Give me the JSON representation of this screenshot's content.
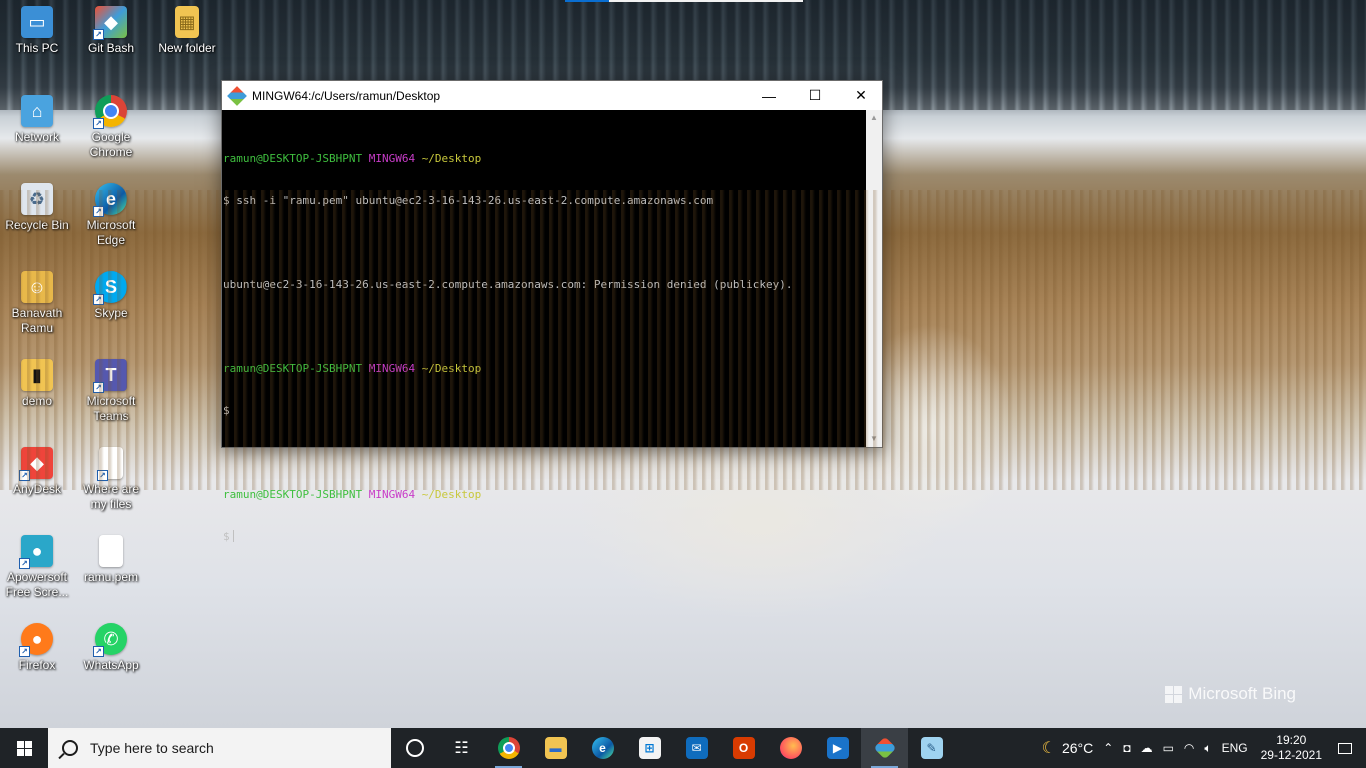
{
  "desktop_icons": [
    {
      "label": "This PC",
      "icon": "computer-icon"
    },
    {
      "label": "Git Bash",
      "icon": "git-bash-icon"
    },
    {
      "label": "New folder",
      "icon": "folder-icon"
    },
    {
      "label": "Network",
      "icon": "network-icon"
    },
    {
      "label": "Google\nChrome",
      "icon": "chrome-icon"
    },
    {
      "label": "Recycle Bin",
      "icon": "recycle-bin-icon"
    },
    {
      "label": "Microsoft\nEdge",
      "icon": "edge-icon"
    },
    {
      "label": "Banavath\nRamu",
      "icon": "user-folder-icon"
    },
    {
      "label": "Skype",
      "icon": "skype-icon"
    },
    {
      "label": "demo",
      "icon": "file-icon"
    },
    {
      "label": "Microsoft\nTeams",
      "icon": "teams-icon"
    },
    {
      "label": "AnyDesk",
      "icon": "anydesk-icon"
    },
    {
      "label": "Where are\nmy files",
      "icon": "document-icon"
    },
    {
      "label": "Apowersoft\nFree Scre...",
      "icon": "apowersoft-icon"
    },
    {
      "label": "ramu.pem",
      "icon": "document-icon"
    },
    {
      "label": "Firefox",
      "icon": "firefox-icon"
    },
    {
      "label": "WhatsApp",
      "icon": "whatsapp-icon"
    }
  ],
  "terminal": {
    "title": "MINGW64:/c/Users/ramun/Desktop",
    "buttons": {
      "minimize": "—",
      "maximize": "☐",
      "close": "✕"
    },
    "lines": [
      {
        "user": "ramun@DESKTOP-JSBHPNT",
        "env": "MINGW64",
        "path": "~/Desktop"
      },
      {
        "text": "$ ssh -i \"ramu.pem\" ubuntu@ec2-3-16-143-26.us-east-2.compute.amazonaws.com"
      },
      {
        "text": ""
      },
      {
        "text": "ubuntu@ec2-3-16-143-26.us-east-2.compute.amazonaws.com: Permission denied (publickey)."
      },
      {
        "text": ""
      },
      {
        "user": "ramun@DESKTOP-JSBHPNT",
        "env": "MINGW64",
        "path": "~/Desktop"
      },
      {
        "text": "$"
      },
      {
        "text": ""
      },
      {
        "user": "ramun@DESKTOP-JSBHPNT",
        "env": "MINGW64",
        "path": "~/Desktop"
      },
      {
        "text": "$"
      }
    ]
  },
  "watermark": {
    "text": "Microsoft Bing"
  },
  "taskbar": {
    "search_placeholder": "Type here to search",
    "pinned": [
      {
        "name": "task-view",
        "icon": "task-view-icon"
      },
      {
        "name": "timeline",
        "icon": "timeline-icon"
      },
      {
        "name": "chrome",
        "icon": "chrome-icon"
      },
      {
        "name": "file-explorer",
        "icon": "folder-icon"
      },
      {
        "name": "edge",
        "icon": "edge-icon"
      },
      {
        "name": "store",
        "icon": "store-icon"
      },
      {
        "name": "mail",
        "icon": "mail-icon"
      },
      {
        "name": "office",
        "icon": "office-icon"
      },
      {
        "name": "firefox",
        "icon": "firefox-icon"
      },
      {
        "name": "media-player",
        "icon": "media-player-icon"
      },
      {
        "name": "git-bash",
        "icon": "git-bash-icon"
      },
      {
        "name": "notepad",
        "icon": "notepad-icon"
      }
    ],
    "weather": "26°C",
    "language": "ENG",
    "time": "19:20",
    "date": "29-12-2021"
  },
  "colors": {
    "taskbar_bg": "#1f2327",
    "prompt_user": "#3fbf3f",
    "prompt_env": "#c83cc8",
    "prompt_path": "#c8c83c"
  }
}
